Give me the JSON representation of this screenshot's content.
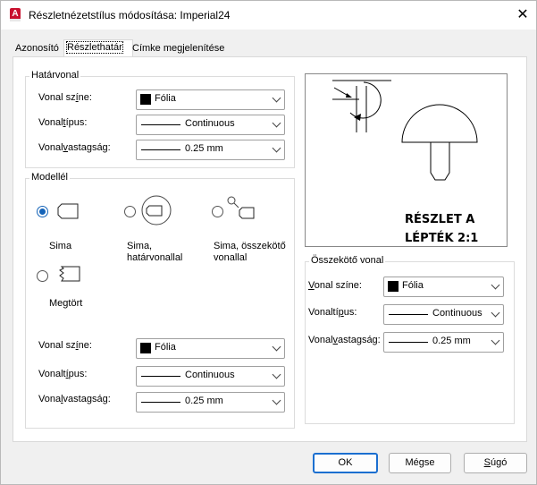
{
  "window": {
    "title": "Részletnézetstílus módosítása: Imperial24",
    "close_glyph": "✕",
    "app_icon_letter": "A"
  },
  "tabs": [
    {
      "label": "Azonosító"
    },
    {
      "label": "Részlethatár"
    },
    {
      "label": "Címke megjelenítése"
    }
  ],
  "boundary_group": {
    "title": "Határvonal",
    "color_label": "Vonal színe:",
    "color_value": "Fólia",
    "linetype_label": "Vonaltípus:",
    "linetype_value": "Continuous",
    "lineweight_label": "Vonalvastagság:",
    "lineweight_value": "0.25 mm"
  },
  "model_group": {
    "title": "Modellél",
    "options": [
      {
        "label_line1": "Sima",
        "label_line2": "",
        "checked": true
      },
      {
        "label_line1": "Sima,",
        "label_line2": "határvonallal",
        "checked": false
      },
      {
        "label_line1": "Sima, összekötő",
        "label_line2": "vonallal",
        "checked": false
      },
      {
        "label_line1": "Megtört",
        "label_line2": "",
        "checked": false
      }
    ],
    "color_label": "Vonal színe:",
    "color_value": "Fólia",
    "linetype_label": "Vonaltípus:",
    "linetype_value": "Continuous",
    "lineweight_label": "Vonalvastagság:",
    "lineweight_value": "0.25 mm"
  },
  "preview": {
    "label_line1": "RÉSZLET A",
    "label_line2": "LÉPTÉK 2:1"
  },
  "connector_group": {
    "title": "Összekötő vonal",
    "color_label": "Vonal színe:",
    "color_value": "Fólia",
    "linetype_label": "Vonaltípus:",
    "linetype_value": "Continuous",
    "lineweight_label": "Vonalvastagság:",
    "lineweight_value": "0.25 mm"
  },
  "buttons": {
    "ok": "OK",
    "cancel": "Mégse",
    "help": "Súgó"
  },
  "colors": {
    "accent": "#1b6fd0",
    "radio_checked": "#1463b8",
    "app_icon": "#c8102e"
  }
}
